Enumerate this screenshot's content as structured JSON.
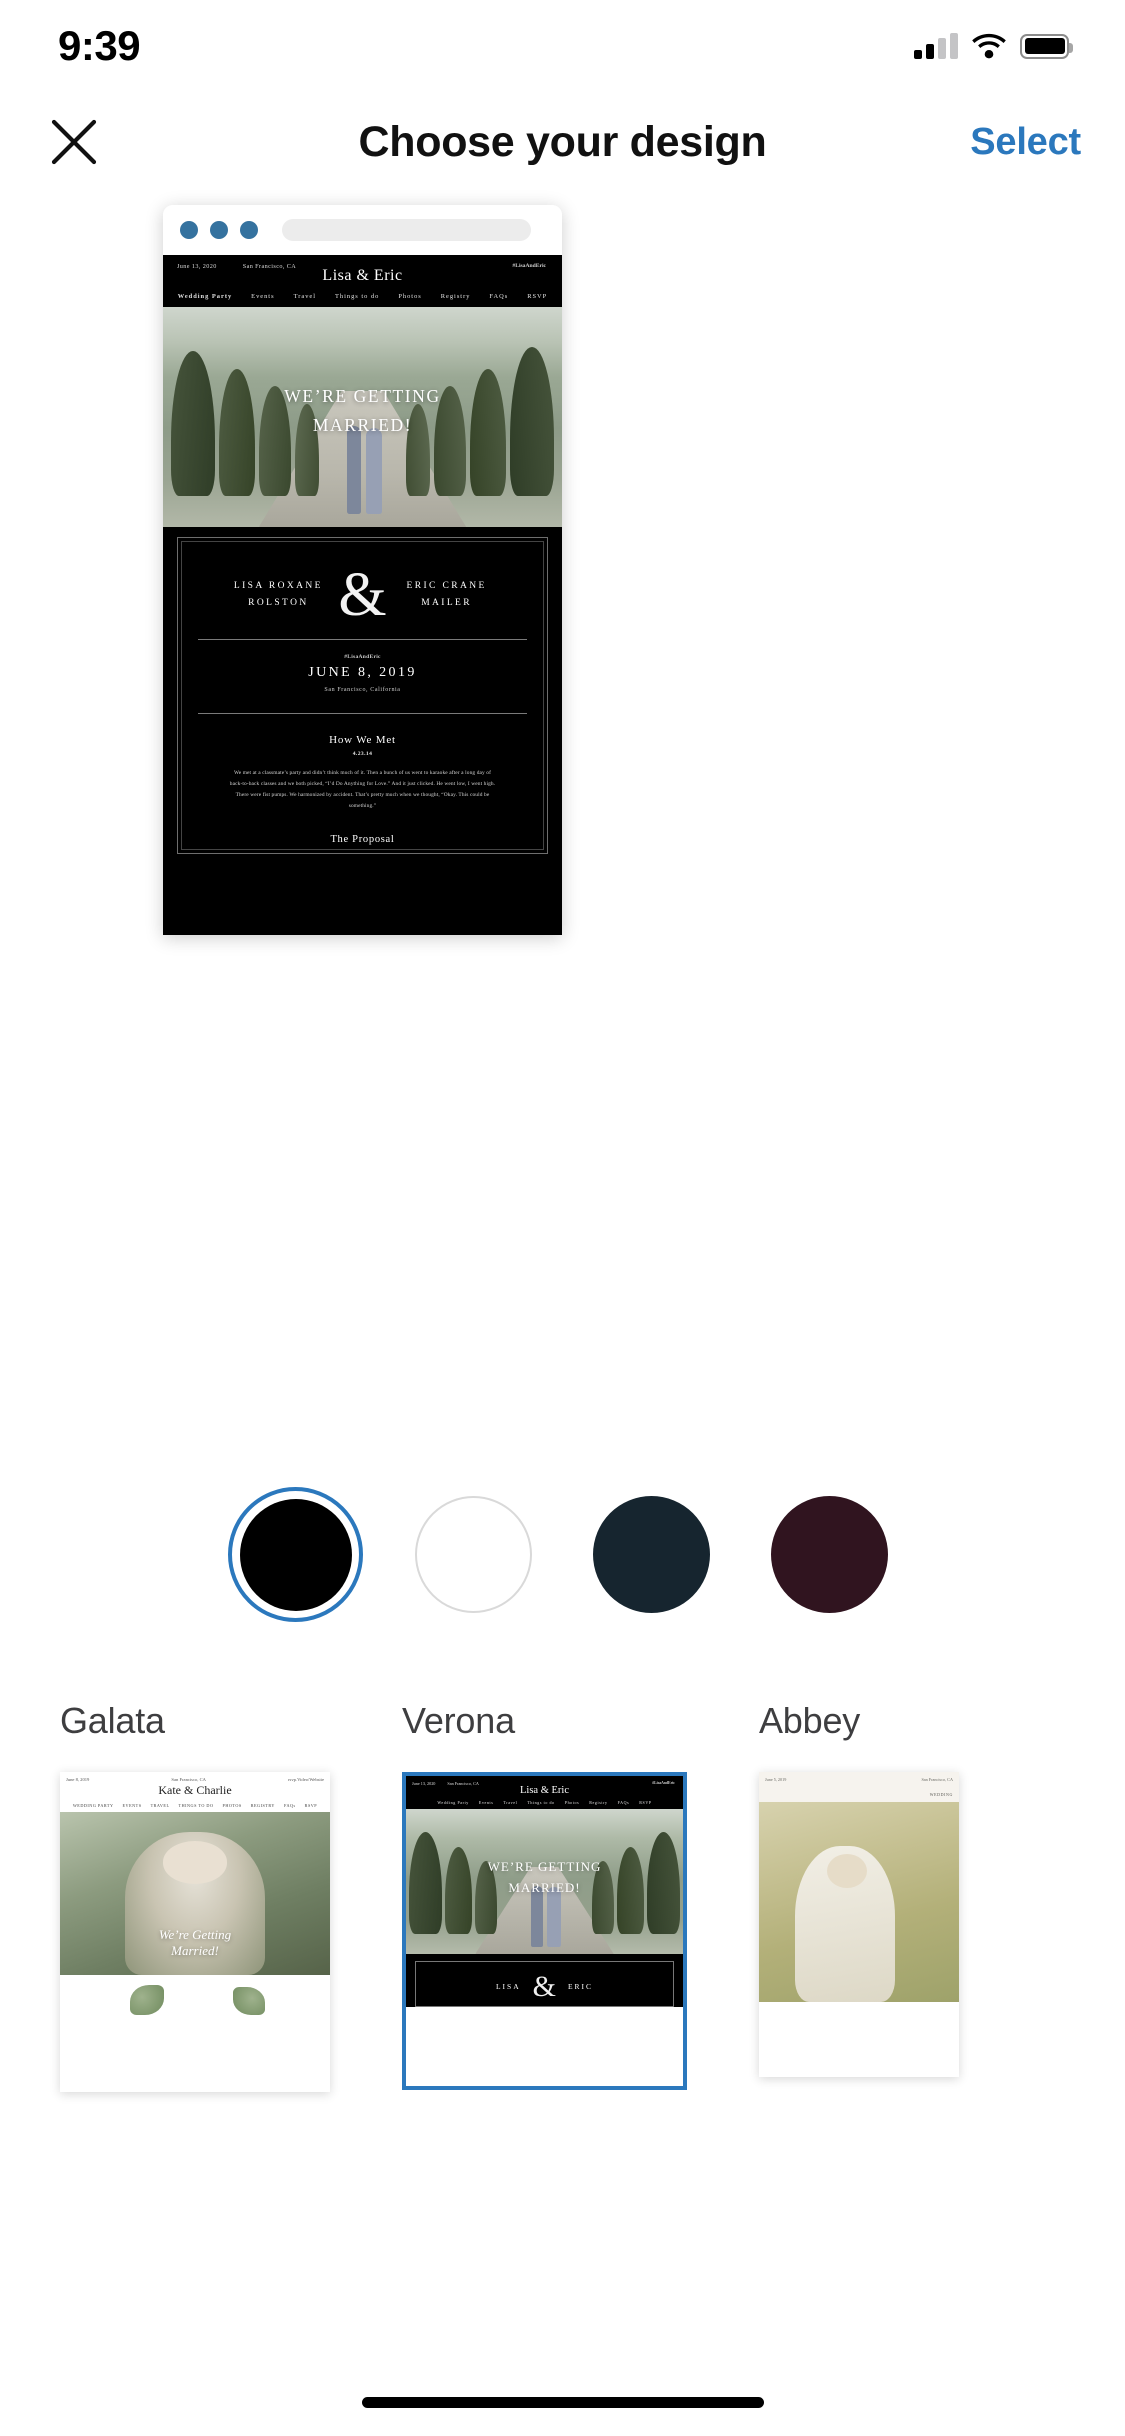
{
  "status_bar": {
    "time": "9:39",
    "signal_icon": "cellular-signal-icon",
    "wifi_icon": "wifi-icon",
    "battery_icon": "battery-icon"
  },
  "nav": {
    "close_icon": "close-icon",
    "title": "Choose your design",
    "select_label": "Select"
  },
  "preview": {
    "browser": {
      "dot_color": "#35729f",
      "url_value": ""
    },
    "site": {
      "date_meta": "June 13, 2020",
      "location_meta": "San Francisco, CA",
      "hashtag": "#LisaAndEric",
      "couple_title": "Lisa & Eric",
      "nav_items": [
        "Wedding Party",
        "Events",
        "Travel",
        "Things to do",
        "Photos",
        "Registry",
        "FAQs",
        "RSVP"
      ],
      "hero_line1": "WE’RE GETTING",
      "hero_line2": "MARRIED!",
      "bride_name": "LISA ROXANE ROLSTON",
      "ampersand": "&",
      "groom_name": "ERIC CRANE MAILER",
      "card_hashtag": "#LisaAndEric",
      "wedding_date": "JUNE 8, 2019",
      "wedding_city": "San Francisco, California",
      "how_we_met_title": "How We Met",
      "how_we_met_date": "4.23.14",
      "how_we_met_body": "We met at a classmate’s party and didn’t think much of it. Then a bunch of us went to karaoke after a long day of back-to-back classes and we both picked, “I’d Do Anything for Love.” And it just clicked. He went low, I went high. There were fist pumps. We harmonized by accident. That’s pretty much when we thought, “Okay. This could be something.”",
      "proposal_title": "The Proposal"
    }
  },
  "color_swatches": {
    "selected_index": 0,
    "selection_ring_color": "#2b78bd",
    "items": [
      {
        "name": "black",
        "hex": "#000000",
        "selected": true
      },
      {
        "name": "white",
        "hex": "#ffffff",
        "selected": false
      },
      {
        "name": "navy",
        "hex": "#16252f",
        "selected": false
      },
      {
        "name": "plum",
        "hex": "#30141f",
        "selected": false
      }
    ]
  },
  "designs": [
    {
      "label": "Galata",
      "selected": false,
      "site": {
        "date_meta": "June 8, 2019",
        "location_meta": "San Francisco, CA",
        "rsvp_meta": "rsvp.Video/Website",
        "couple_title": "Kate & Charlie",
        "nav_items": [
          "WEDDING PARTY",
          "EVENTS",
          "TRAVEL",
          "THINGS TO DO",
          "PHOTOS",
          "REGISTRY",
          "FAQs",
          "RSVP"
        ],
        "hero_line1": "We’re Getting",
        "hero_line2": "Married!"
      }
    },
    {
      "label": "Verona",
      "selected": true,
      "checkmark_icon": "checkmark-icon",
      "site": {
        "date_meta": "June 13, 2020",
        "location_meta": "San Francisco, CA",
        "hashtag": "#LisaAndEric",
        "couple_title": "Lisa & Eric",
        "nav_items": [
          "Wedding Party",
          "Events",
          "Travel",
          "Things to do",
          "Photos",
          "Registry",
          "FAQs",
          "RSVP"
        ],
        "hero_line1": "WE’RE GETTING",
        "hero_line2": "MARRIED!",
        "bride_name": "LISA",
        "ampersand": "&",
        "groom_name": "ERIC"
      }
    },
    {
      "label": "Abbey",
      "selected": false,
      "site": {
        "date_meta": "June 5, 2019",
        "location_meta": "San Francisco, CA",
        "nav_items": [
          "WEDDING"
        ]
      }
    }
  ],
  "home_indicator": "home-indicator"
}
